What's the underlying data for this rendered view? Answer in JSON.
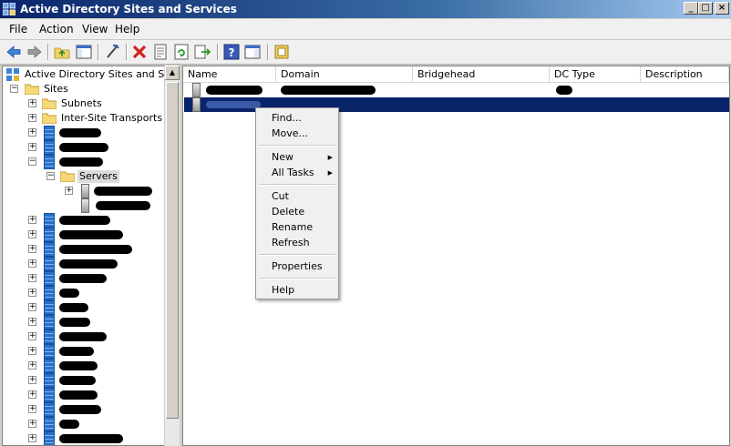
{
  "window": {
    "title": "Active Directory Sites and Services",
    "controls": [
      "_",
      "□",
      "×"
    ]
  },
  "menu": [
    "File",
    "Action",
    "View",
    "Help"
  ],
  "toolbar": [
    "back-icon",
    "forward-icon",
    "up-folder-icon",
    "show-hide-console-tree-icon",
    "link-icon",
    "delete-icon",
    "properties-icon",
    "refresh-icon",
    "export-list-icon",
    "help-icon",
    "action-pane-icon",
    "mmc-icon"
  ],
  "tree": {
    "root": "Active Directory Sites and Servic",
    "sites": "Sites",
    "subnets": "Subnets",
    "inter_site": "Inter-Site Transports",
    "servers": "Servers"
  },
  "list": {
    "columns": [
      "Name",
      "Domain",
      "Bridgehead",
      "DC Type",
      "Description"
    ]
  },
  "context_menu": {
    "find": "Find...",
    "move": "Move...",
    "new": "New",
    "all_tasks": "All Tasks",
    "cut": "Cut",
    "delete": "Delete",
    "rename": "Rename",
    "refresh": "Refresh",
    "properties": "Properties",
    "help": "Help"
  },
  "colors": {
    "title_start": "#0a246a",
    "title_end": "#a6caf0",
    "selection": "#0a246a"
  }
}
